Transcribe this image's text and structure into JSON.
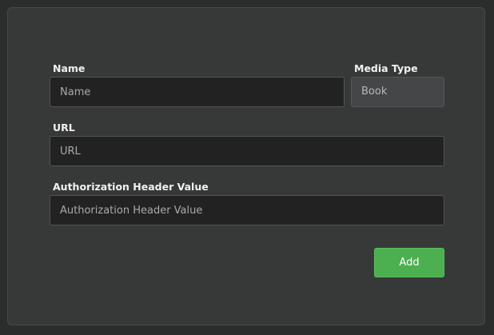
{
  "form": {
    "name": {
      "label": "Name",
      "placeholder": "Name",
      "value": ""
    },
    "media_type": {
      "label": "Media Type",
      "selected": "Book"
    },
    "url": {
      "label": "URL",
      "placeholder": "URL",
      "value": ""
    },
    "auth_header": {
      "label": "Authorization Header Value",
      "placeholder": "Authorization Header Value",
      "value": ""
    },
    "add_button_label": "Add"
  },
  "colors": {
    "background": "#2b2c2c",
    "panel": "#373938",
    "input_background": "#222223",
    "button_accent": "#4caf50"
  }
}
